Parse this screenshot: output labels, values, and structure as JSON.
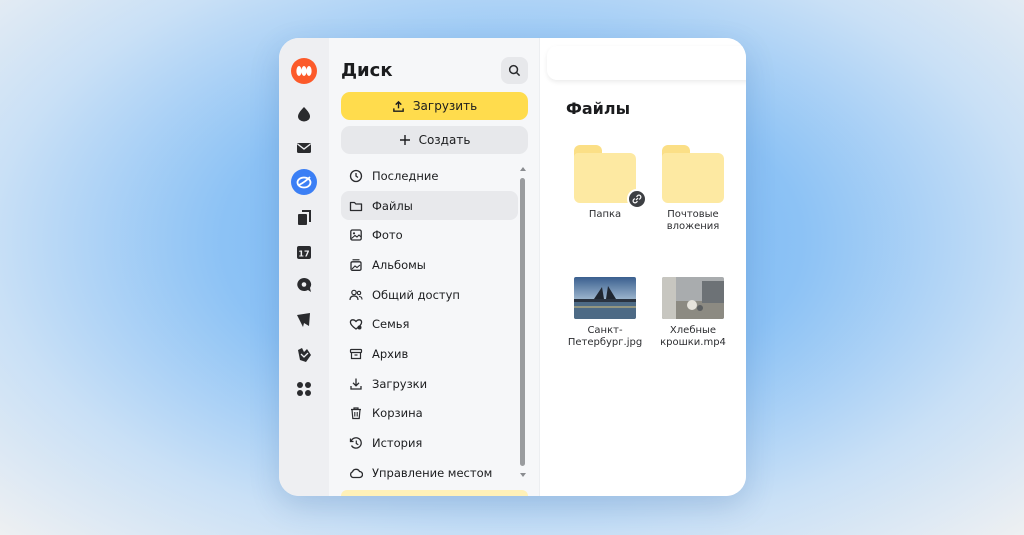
{
  "sidebar": {
    "title": "Диск",
    "upload_label": "Загрузить",
    "create_label": "Создать",
    "items": [
      {
        "label": "Последние",
        "icon": "clock-icon"
      },
      {
        "label": "Файлы",
        "icon": "folder-icon",
        "active": true
      },
      {
        "label": "Фото",
        "icon": "photo-icon"
      },
      {
        "label": "Альбомы",
        "icon": "albums-icon"
      },
      {
        "label": "Общий доступ",
        "icon": "users-icon"
      },
      {
        "label": "Семья",
        "icon": "family-heart-icon"
      },
      {
        "label": "Архив",
        "icon": "archive-icon"
      },
      {
        "label": "Загрузки",
        "icon": "download-icon"
      },
      {
        "label": "Корзина",
        "icon": "trash-icon"
      },
      {
        "label": "История",
        "icon": "history-icon"
      },
      {
        "label": "Управление местом",
        "icon": "cloud-icon"
      }
    ]
  },
  "rail": {
    "icons": [
      "yandex-logo-icon",
      "cloud-drop-icon",
      "mail-icon",
      "disk-icon",
      "docs-icon",
      "calendar-icon",
      "messenger-icon",
      "telemost-icon",
      "forms-icon",
      "apps-grid-icon"
    ],
    "calendar_day": "17"
  },
  "main": {
    "title": "Файлы",
    "files": [
      {
        "name": "Папка",
        "type": "folder",
        "shared": true
      },
      {
        "name": "Почтовые вложения",
        "type": "folder",
        "shared": false
      },
      {
        "name": "Санкт-Петербург.jpg",
        "type": "image"
      },
      {
        "name": "Хлебные крошки.mp4",
        "type": "video"
      }
    ]
  },
  "colors": {
    "accent_yellow": "#ffdc4d",
    "active_blue": "#3b7ff5",
    "logo_orange": "#fc5a2a",
    "folder_yellow": "#fde9a2"
  }
}
